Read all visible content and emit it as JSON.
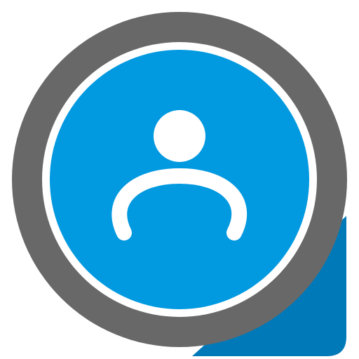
{
  "icon": {
    "semantic_name": "user-profile-icon",
    "glyph": "person-silhouette-icon"
  },
  "colors": {
    "outer_ring": "#686868",
    "white_gap": "#ffffff",
    "inner_disc": "#0199E0",
    "corner_tab": "#0079B8",
    "person": "#ffffff"
  }
}
